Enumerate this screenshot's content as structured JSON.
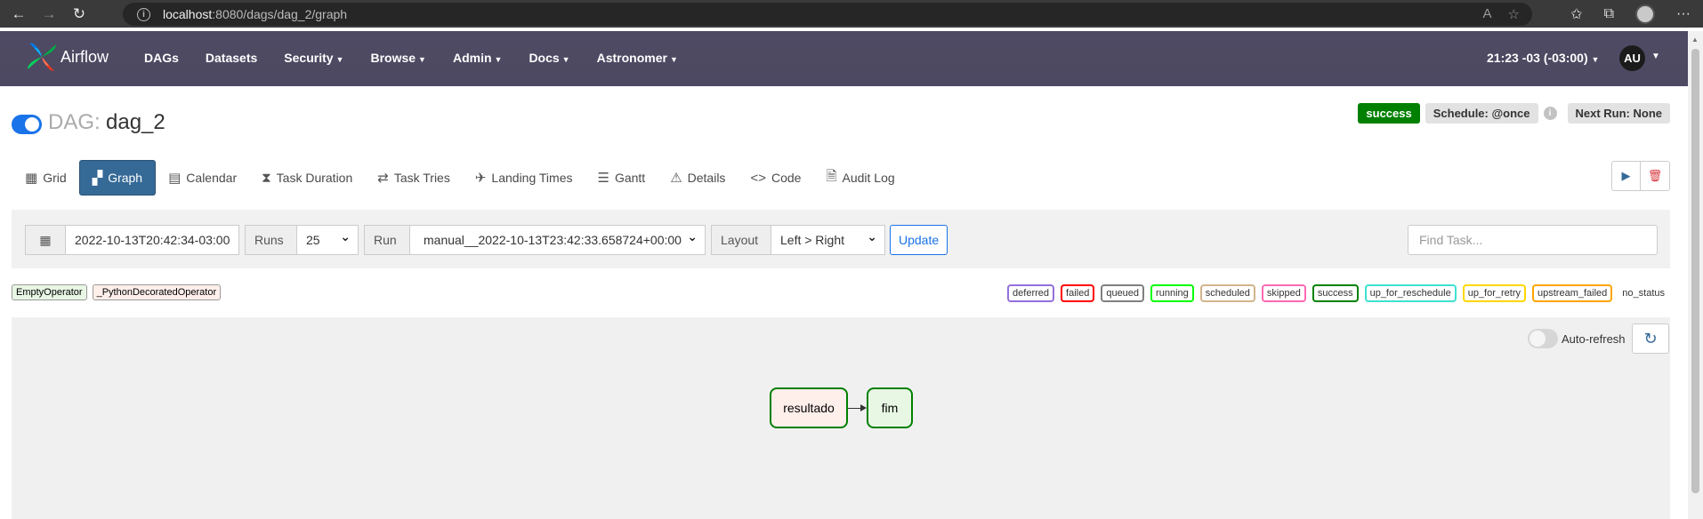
{
  "browser": {
    "url_host": "localhost",
    "url_path": ":8080/dags/dag_2/graph"
  },
  "navbar": {
    "brand": "Airflow",
    "menu": [
      "DAGs",
      "Datasets",
      "Security",
      "Browse",
      "Admin",
      "Docs",
      "Astronomer"
    ],
    "clock": "21:23 -03 (-03:00)",
    "user_initials": "AU"
  },
  "dag": {
    "label": "DAG:",
    "id": "dag_2",
    "status": "success",
    "schedule": "Schedule: @once",
    "next_run": "Next Run: None"
  },
  "tabs": [
    {
      "label": "Grid",
      "icon": "grid-icon"
    },
    {
      "label": "Graph",
      "icon": "graph-icon",
      "active": true
    },
    {
      "label": "Calendar",
      "icon": "calendar-icon"
    },
    {
      "label": "Task Duration",
      "icon": "hourglass-icon"
    },
    {
      "label": "Task Tries",
      "icon": "retry-icon"
    },
    {
      "label": "Landing Times",
      "icon": "plane-landing-icon"
    },
    {
      "label": "Gantt",
      "icon": "gantt-icon"
    },
    {
      "label": "Details",
      "icon": "warning-triangle-icon"
    },
    {
      "label": "Code",
      "icon": "code-icon"
    },
    {
      "label": "Audit Log",
      "icon": "file-search-icon"
    }
  ],
  "controls": {
    "base_date": "2022-10-13T20:42:34-03:00",
    "runs_label": "Runs",
    "runs_value": "25",
    "run_label": "Run",
    "run_value": "manual__2022-10-13T23:42:33.658724+00:00",
    "layout_label": "Layout",
    "layout_value": "Left > Right",
    "update_label": "Update",
    "find_placeholder": "Find Task..."
  },
  "operators": [
    {
      "name": "EmptyOperator",
      "color": "#e8f7e4"
    },
    {
      "name": "_PythonDecoratedOperator",
      "color": "#ffefeb"
    }
  ],
  "states": [
    {
      "name": "deferred",
      "color": "#9370db"
    },
    {
      "name": "failed",
      "color": "#ff0000"
    },
    {
      "name": "queued",
      "color": "#808080"
    },
    {
      "name": "running",
      "color": "#00ff00"
    },
    {
      "name": "scheduled",
      "color": "#d2b48c"
    },
    {
      "name": "skipped",
      "color": "#ff69b4"
    },
    {
      "name": "success",
      "color": "#008000"
    },
    {
      "name": "up_for_reschedule",
      "color": "#40e0d0"
    },
    {
      "name": "up_for_retry",
      "color": "#ffd700"
    },
    {
      "name": "upstream_failed",
      "color": "#ffa500"
    },
    {
      "name": "no_status",
      "color": ""
    }
  ],
  "graph": {
    "auto_refresh_label": "Auto-refresh",
    "nodes": [
      "resultado",
      "fim"
    ]
  }
}
